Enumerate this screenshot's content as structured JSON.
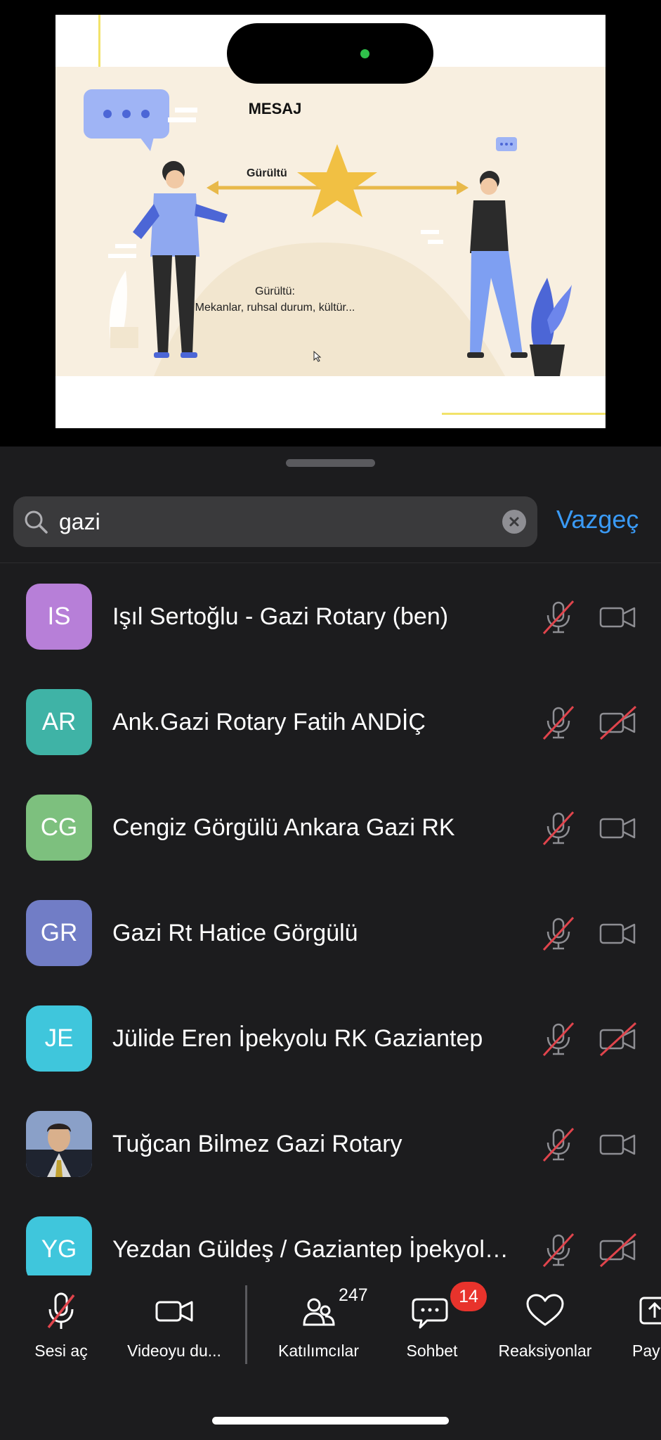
{
  "slide": {
    "title": "MESAJ",
    "noise_label": "Gürültü",
    "caption_line1": "Gürültü:",
    "caption_line2": "Mekanlar, ruhsal durum, kültür..."
  },
  "search": {
    "query": "gazi",
    "cancel_label": "Vazgeç"
  },
  "participants": [
    {
      "initials": "IS",
      "name": "Işıl Sertoğlu - Gazi Rotary (ben)",
      "avatar_color": "#b77fd8",
      "mic_muted": true,
      "video_off": false
    },
    {
      "initials": "AR",
      "name": "Ank.Gazi Rotary Fatih ANDİÇ",
      "avatar_color": "#3fb3a6",
      "mic_muted": true,
      "video_off": true
    },
    {
      "initials": "CG",
      "name": "Cengiz Görgülü Ankara Gazi RK",
      "avatar_color": "#7dc07e",
      "mic_muted": true,
      "video_off": false
    },
    {
      "initials": "GR",
      "name": "Gazi Rt Hatice Görgülü",
      "avatar_color": "#717dc6",
      "mic_muted": true,
      "video_off": false
    },
    {
      "initials": "JE",
      "name": "Jülide Eren İpekyolu RK Gaziantep",
      "avatar_color": "#3fc6dc",
      "mic_muted": true,
      "video_off": true
    },
    {
      "initials": "",
      "name": "Tuğcan Bilmez Gazi Rotary",
      "avatar_color": "#5a6f9a",
      "mic_muted": true,
      "video_off": false
    },
    {
      "initials": "YG",
      "name": "Yezdan Güldeş / Gaziantep İpekyolu RK",
      "avatar_color": "#3fc6dc",
      "mic_muted": true,
      "video_off": true
    }
  ],
  "toolbar": {
    "unmute_label": "Sesi aç",
    "video_label": "Videoyu du...",
    "participants_label": "Katılımcılar",
    "participants_count": "247",
    "chat_label": "Sohbet",
    "chat_badge": "14",
    "reactions_label": "Reaksiyonlar",
    "share_label": "Pay"
  },
  "colors": {
    "accent": "#3a9af5",
    "muted_slash": "#e0444c",
    "badge": "#e8332c"
  }
}
